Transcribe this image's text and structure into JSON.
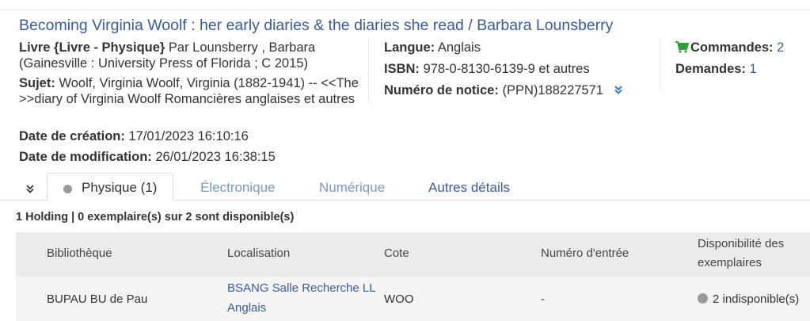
{
  "record": {
    "title": "Becoming Virginia Woolf : her early diaries & the diaries she read / Barbara Lounsberry",
    "type_label": "Livre {Livre - Physique}",
    "author_text": "Par Lounsberry , Barbara",
    "publication": "(Gainesville : University Press of Florida ; C 2015)",
    "subject_label": "Sujet:",
    "subject_value": "Woolf, Virginia Woolf, Virginia (1882-1941) -- <<The >>diary of Virginia Woolf Romancières anglaises et autres",
    "language_label": "Langue:",
    "language_value": "Anglais",
    "isbn_label": "ISBN:",
    "isbn_value": "978-0-8130-6139-9 et autres",
    "notice_label": "Numéro de notice:",
    "notice_value": "(PPN)188227571",
    "orders_label": "Commandes:",
    "orders_value": "2",
    "requests_label": "Demandes:",
    "requests_value": "1",
    "created_label": "Date de création:",
    "created_value": "17/01/2023 16:10:16",
    "modified_label": "Date de modification:",
    "modified_value": "26/01/2023 16:38:15"
  },
  "tabs": {
    "physical": "Physique (1)",
    "electronic": "Électronique",
    "digital": "Numérique",
    "other": "Autres détails"
  },
  "holdings": {
    "summary": "1 Holding | 0 exemplaire(s) sur 2 sont disponible(s)",
    "columns": [
      "Bibliothèque",
      "Localisation",
      "Cote",
      "Numéro d'entrée",
      "Disponibilité des exemplaires"
    ],
    "rows": [
      {
        "library": "BUPAU BU de Pau",
        "location": "BSANG Salle Recherche LL Anglais",
        "call_number": "WOO",
        "accession": "-",
        "availability": "2 indisponible(s)"
      }
    ]
  },
  "colors": {
    "link": "#3a5a9a",
    "disabled_tab": "#7d97bd",
    "cart_green": "#2e9e3e",
    "header_bg": "#ebebeb",
    "row_bg": "#f4f4f4"
  }
}
